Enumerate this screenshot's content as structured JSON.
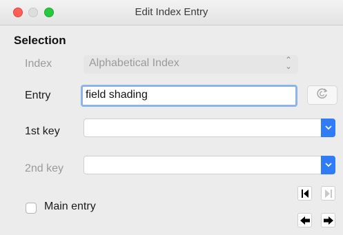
{
  "window": {
    "title": "Edit Index Entry"
  },
  "section": {
    "title": "Selection"
  },
  "index": {
    "label": "Index",
    "value": "Alphabetical Index"
  },
  "entry": {
    "label": "Entry",
    "value": "field shading"
  },
  "key1": {
    "label": "1st key",
    "value": ""
  },
  "key2": {
    "label": "2nd key",
    "value": ""
  },
  "main_entry": {
    "label": "Main entry",
    "checked": false
  },
  "icons": {
    "refresh": "refresh-icon",
    "first": "skip-to-first-icon",
    "last": "skip-to-last-icon",
    "previous": "arrow-left-icon",
    "next": "arrow-right-icon"
  },
  "colors": {
    "accent": "#2f7cf6",
    "focus_ring": "#8db3e8"
  }
}
